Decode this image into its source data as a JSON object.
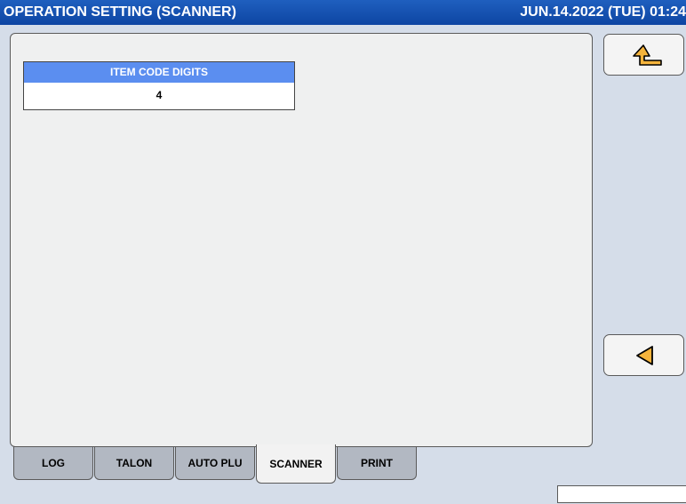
{
  "titlebar": {
    "title": "OPERATION SETTING (SCANNER)",
    "datetime": "JUN.14.2022 (TUE)  01:24"
  },
  "item_code_digits": {
    "label": "ITEM CODE DIGITS",
    "value": "4"
  },
  "side_buttons": {
    "return_icon": "return-arrow-icon",
    "back_icon": "left-triangle-icon",
    "icon_color": "#f5b43c"
  },
  "tabs": [
    {
      "label": "LOG",
      "active": false
    },
    {
      "label": "TALON",
      "active": false
    },
    {
      "label": "AUTO PLU",
      "active": false
    },
    {
      "label": "SCANNER",
      "active": true
    },
    {
      "label": "PRINT",
      "active": false
    }
  ],
  "colors": {
    "title_bar": "#1550b0",
    "field_header": "#5b8ef0",
    "background": "#d5dde9",
    "panel": "#eff0f0",
    "tab_inactive": "#b2b8c2"
  }
}
